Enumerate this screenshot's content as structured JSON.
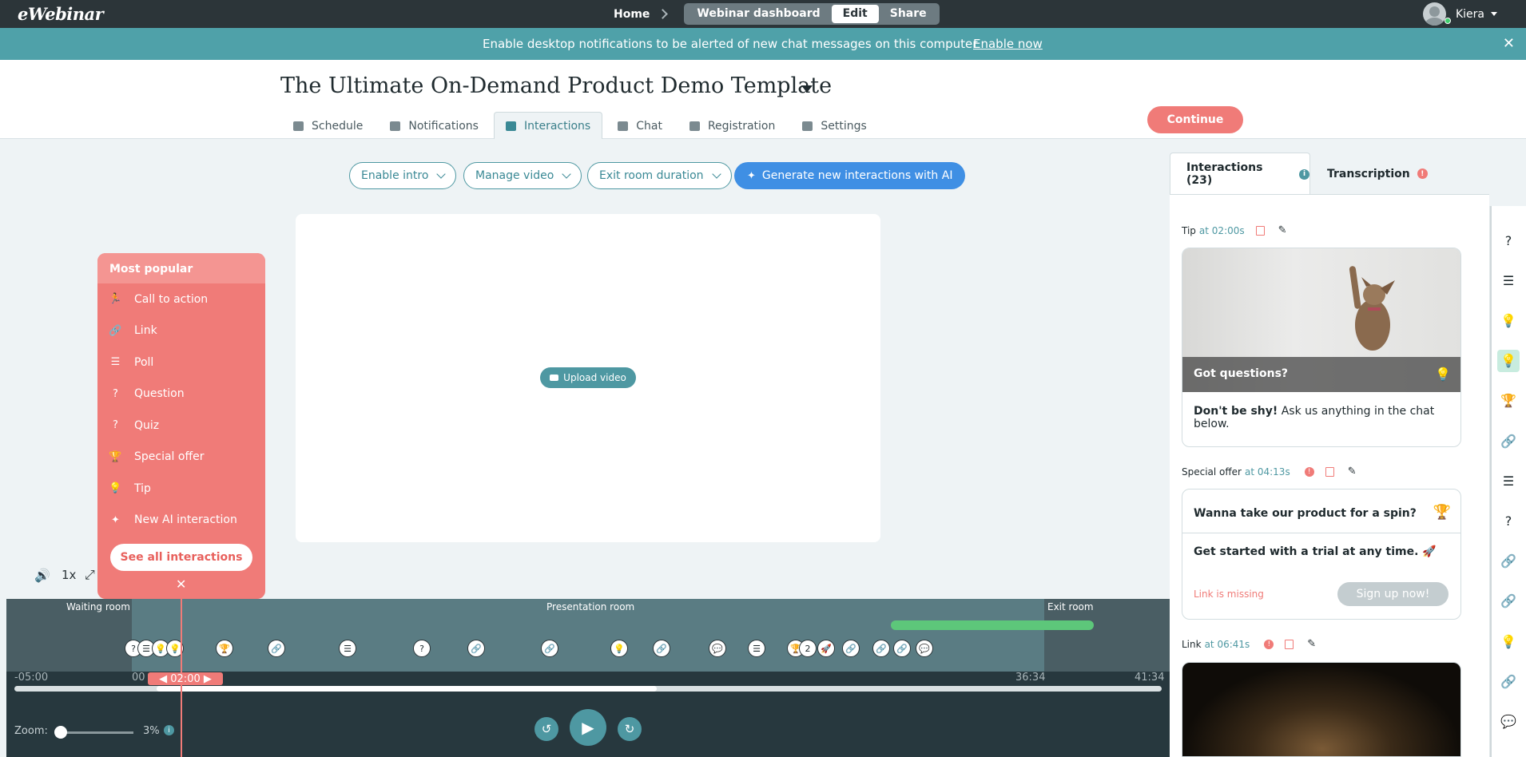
{
  "app": {
    "logo": "eWebinar"
  },
  "topnav": {
    "home": "Home",
    "segments": [
      "Webinar dashboard",
      "Edit",
      "Share"
    ],
    "active_segment": "Edit",
    "user_name": "Kiera"
  },
  "notification": {
    "text": "Enable desktop notifications to be alerted of new chat messages on this computer",
    "link": "Enable now",
    "close": "✕"
  },
  "header": {
    "title": "The Ultimate On-Demand Product Demo Template",
    "tabs": [
      "Schedule",
      "Notifications",
      "Interactions",
      "Chat",
      "Registration",
      "Settings"
    ],
    "active_tab": "Interactions",
    "continue_label": "Continue"
  },
  "toolbar": {
    "enable_intro": "Enable intro",
    "manage_video": "Manage video",
    "exit_room_duration": "Exit room duration",
    "generate_ai": "Generate new interactions with AI"
  },
  "video": {
    "upload_label": "Upload video"
  },
  "popular_menu": {
    "title": "Most popular",
    "items": [
      {
        "label": "Call to action",
        "icon": "🏃"
      },
      {
        "label": "Link",
        "icon": "🔗"
      },
      {
        "label": "Poll",
        "icon": "☰"
      },
      {
        "label": "Question",
        "icon": "?"
      },
      {
        "label": "Quiz",
        "icon": "?"
      },
      {
        "label": "Special offer",
        "icon": "🏆"
      },
      {
        "label": "Tip",
        "icon": "💡"
      },
      {
        "label": "New AI interaction",
        "icon": "✦"
      }
    ],
    "see_all": "See all interactions",
    "close": "✕"
  },
  "player": {
    "speed": "1x",
    "volume_icon": "🔊",
    "expand_icon": "⤢"
  },
  "timeline": {
    "rooms": {
      "waiting": "Waiting room",
      "presentation": "Presentation room",
      "exit": "Exit room"
    },
    "time_start": "-05:00",
    "time_zero": "00",
    "playhead_time": "02:00",
    "time_end_presentation": "36:34",
    "time_end_exit": "41:34",
    "progress_fraction": 0.56,
    "zoom_label": "Zoom:",
    "zoom_value": "3%",
    "marker_badge": "2",
    "markers": [
      "?",
      "☰",
      "💡",
      "💡",
      "🏆",
      "🔗",
      "☰",
      "?",
      "🔗",
      "🔗",
      "💡",
      "🔗",
      "💬",
      "☰",
      "🏆",
      "🚀",
      "🔗",
      "🔗",
      "🔗",
      "💬"
    ]
  },
  "right_panel": {
    "tabs": [
      {
        "label": "Interactions (23)",
        "info_color": "#4e98a2"
      },
      {
        "label": "Transcription",
        "info_color": "#f07b78"
      }
    ],
    "active_tab": "Interactions (23)",
    "cards": {
      "tip": {
        "type": "Tip",
        "at": "at 02:00s",
        "caption": "Got questions?",
        "body_bold": "Don't be shy!",
        "body": " Ask us anything in the chat below."
      },
      "offer": {
        "type": "Special offer",
        "at": "at 04:13s",
        "headline": "Wanna take our product for a spin?",
        "body": "Get started with a trial at any time. 🚀",
        "link_missing": "Link is missing",
        "cta": "Sign up now!"
      },
      "link": {
        "type": "Link",
        "at": "at 06:41s"
      }
    }
  },
  "rail": {
    "icons": [
      "question-icon",
      "poll-icon",
      "tip-icon",
      "tip-icon",
      "trophy-icon",
      "link-icon",
      "poll-icon",
      "question-icon",
      "link-icon",
      "link-icon",
      "tip-icon",
      "link-icon",
      "chat-icon"
    ],
    "glyphs": [
      "?",
      "☰",
      "💡",
      "💡",
      "🏆",
      "🔗",
      "☰",
      "?",
      "🔗",
      "🔗",
      "💡",
      "🔗",
      "💬"
    ],
    "active_index": 3
  },
  "colors": {
    "accent": "#4e98a2",
    "coral": "#f07b78",
    "ai_blue": "#3f8fe4",
    "topbar": "#2c3539",
    "timeline": "#27383e"
  }
}
